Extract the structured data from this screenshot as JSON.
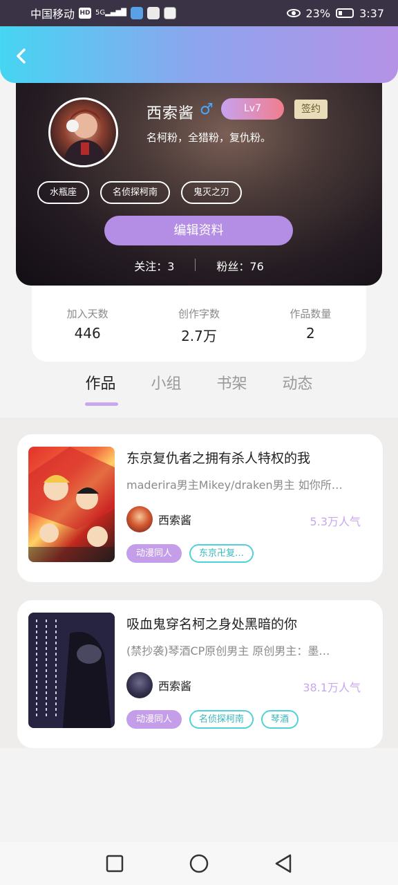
{
  "status_bar": {
    "carrier": "中国移动",
    "hd_badge": "HD",
    "network": "5G",
    "battery": "23%",
    "time": "3:37"
  },
  "profile": {
    "username": "西索酱",
    "gender_symbol": "♂",
    "level": "Lv7",
    "signed_badge": "签约",
    "bio": "名柯粉，全猎粉，复仇粉。",
    "tags": [
      "水瓶座",
      "名侦探柯南",
      "鬼灭之刃"
    ],
    "edit_label": "编辑资料",
    "following_label": "关注：3",
    "followers_label": "粉丝：76"
  },
  "stats": [
    {
      "label": "加入天数",
      "value": "446"
    },
    {
      "label": "创作字数",
      "value": "2.7万"
    },
    {
      "label": "作品数量",
      "value": "2"
    }
  ],
  "tabs": [
    {
      "label": "作品",
      "active": true
    },
    {
      "label": "小组",
      "active": false
    },
    {
      "label": "书架",
      "active": false
    },
    {
      "label": "动态",
      "active": false
    }
  ],
  "works": [
    {
      "title": "东京复仇者之拥有杀人特权的我",
      "desc": "maderira男主Mikey/draken男主 如你所…",
      "author": "西索酱",
      "popularity": "5.3万人气",
      "tags": [
        "动漫同人",
        "东京卍复…"
      ]
    },
    {
      "title": "吸血鬼穿名柯之身处黑暗的你",
      "desc": "(禁抄袭)琴酒CP原创男主 原创男主：墨…",
      "author": "西索酱",
      "popularity": "38.1万人气",
      "tags": [
        "动漫同人",
        "名侦探柯南",
        "琴酒"
      ]
    }
  ],
  "colors": {
    "accent_purple": "#b48ee4",
    "popularity_text": "#c8a7ee",
    "chip_outline": "#4fd1d6",
    "gender_blue": "#4aa8ff"
  },
  "icons": {
    "back": "chevron-left-icon",
    "recents": "square-icon",
    "home": "circle-icon",
    "back_nav": "triangle-back-icon"
  }
}
